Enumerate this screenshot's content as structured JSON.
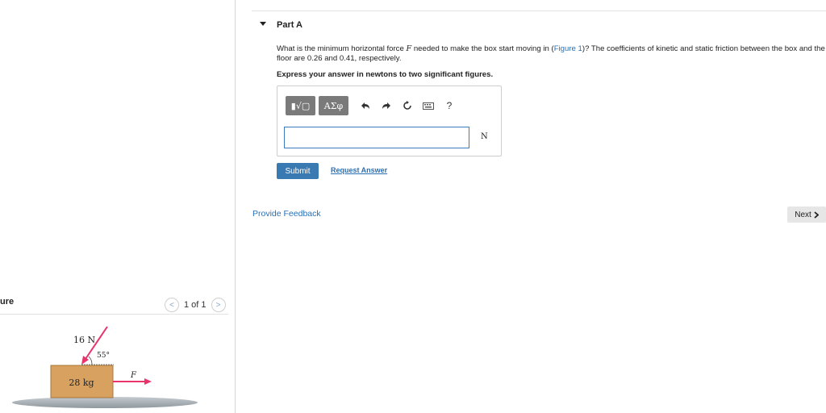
{
  "figure_panel": {
    "title": "ure",
    "pager": "1 of 1",
    "prev_icon": "chevron-left-icon",
    "next_icon": "chevron-right-icon",
    "diagram": {
      "force_label": "16 N",
      "angle_label": "55°",
      "mass_label": "28 kg",
      "applied_force_label": "F",
      "colors": {
        "box": "#d8a15f",
        "arrow": "#e8336b",
        "floor": "#a9b1b7"
      }
    }
  },
  "part": {
    "title": "Part A",
    "question_pre": "What is the minimum horizontal force ",
    "question_var": "F",
    "question_mid": " needed to make the box start moving in (",
    "figure_link": "Figure 1",
    "question_post": ")? The coefficients of kinetic and static friction between the box and the floor are 0.26 and 0.41, respectively.",
    "instruction": "Express your answer in newtons to two significant figures.",
    "toolbar": {
      "template_label": "▮√▢",
      "greek_label": "ΑΣφ",
      "undo_icon": "undo-icon",
      "redo_icon": "redo-icon",
      "reset_icon": "reset-icon",
      "keyboard_icon": "keyboard-icon",
      "help_label": "?"
    },
    "answer_value": "",
    "unit": "N",
    "submit_label": "Submit",
    "request_label": "Request Answer"
  },
  "footer": {
    "feedback_label": "Provide Feedback",
    "next_label": "Next",
    "next_icon": "chevron-right-icon"
  }
}
